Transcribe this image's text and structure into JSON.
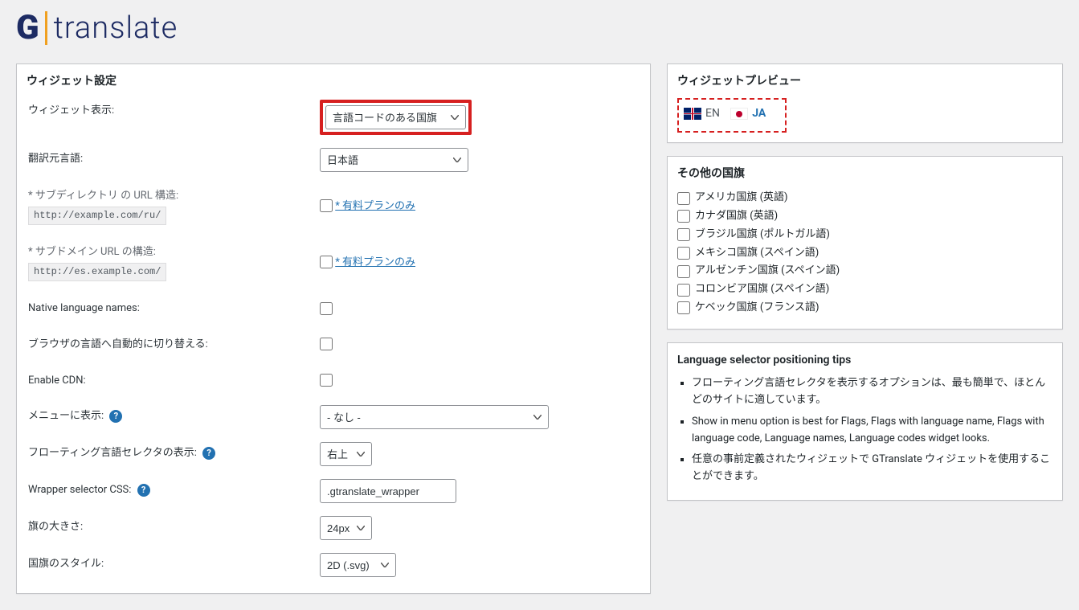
{
  "logo": {
    "g": "G",
    "text": "translate"
  },
  "left_panel_title": "ウィジェット設定",
  "rows": {
    "widget_look": {
      "label": "ウィジェット表示:",
      "value": "言語コードのある国旗"
    },
    "source_lang": {
      "label": "翻訳元言語:",
      "value": "日本語"
    },
    "subdir": {
      "label": "* サブディレクトリ の URL 構造:",
      "url": "http://example.com/ru/",
      "paid": "* 有料プランのみ"
    },
    "subdom": {
      "label": "* サブドメイン URL の構造:",
      "url": "http://es.example.com/",
      "paid": "* 有料プランのみ"
    },
    "native": {
      "label": "Native language names:"
    },
    "browser": {
      "label": "ブラウザの言語へ自動的に切り替える:"
    },
    "cdn": {
      "label": "Enable CDN:"
    },
    "menu": {
      "label": "メニューに表示:",
      "value": "- なし -"
    },
    "floating": {
      "label": "フローティング言語セレクタの表示:",
      "value": "右上"
    },
    "css": {
      "label": "Wrapper selector CSS:",
      "value": ".gtranslate_wrapper"
    },
    "flagsize": {
      "label": "旗の大きさ:",
      "value": "24px"
    },
    "flagstyle": {
      "label": "国旗のスタイル:",
      "value": "2D (.svg)"
    }
  },
  "preview": {
    "title": "ウィジェットプレビュー",
    "en": "EN",
    "ja": "JA"
  },
  "alt_flags": {
    "title": "その他の国旗",
    "items": [
      "アメリカ国旗 (英語)",
      "カナダ国旗 (英語)",
      "ブラジル国旗 (ポルトガル語)",
      "メキシコ国旗 (スペイン語)",
      "アルゼンチン国旗 (スペイン語)",
      "コロンビア国旗 (スペイン語)",
      "ケベック国旗 (フランス語)"
    ]
  },
  "tips": {
    "title": "Language selector positioning tips",
    "items": [
      "フローティング言語セレクタを表示するオプションは、最も簡単で、ほとんどのサイトに適しています。",
      "Show in menu option is best for Flags, Flags with language name, Flags with language code, Language names, Language codes widget looks.",
      "任意の事前定義されたウィジェットで GTranslate ウィジェットを使用することができます。"
    ]
  }
}
